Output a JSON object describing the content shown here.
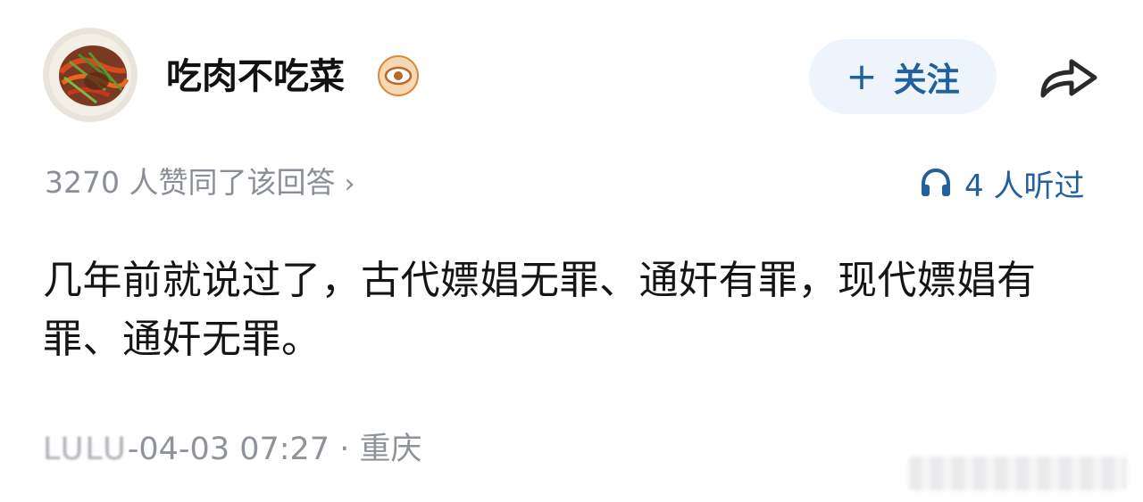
{
  "author": {
    "name": "吃肉不吃菜",
    "avatar_icon": "food-dish-avatar",
    "badge_icon": "eye-badge-icon"
  },
  "follow_button": {
    "plus": "+",
    "label": "关注"
  },
  "share_icon": "share-arrow-icon",
  "stats": {
    "votes_text": "3270 人赞同了该回答",
    "votes_chevron": "›",
    "listened_text": "4 人听过",
    "listened_icon": "headphones-icon"
  },
  "answer": {
    "text": "几年前就说过了，古代嫖娼无罪、通奸有罪，现代嫖娼有罪、通奸无罪。"
  },
  "meta": {
    "blurred_year": "LULU",
    "date_time": "-04-03 07:27",
    "separator": "·",
    "location": "重庆"
  },
  "colors": {
    "accent": "#215f9e",
    "follow_bg": "#eef4fb",
    "muted_text": "#8a8f97"
  }
}
